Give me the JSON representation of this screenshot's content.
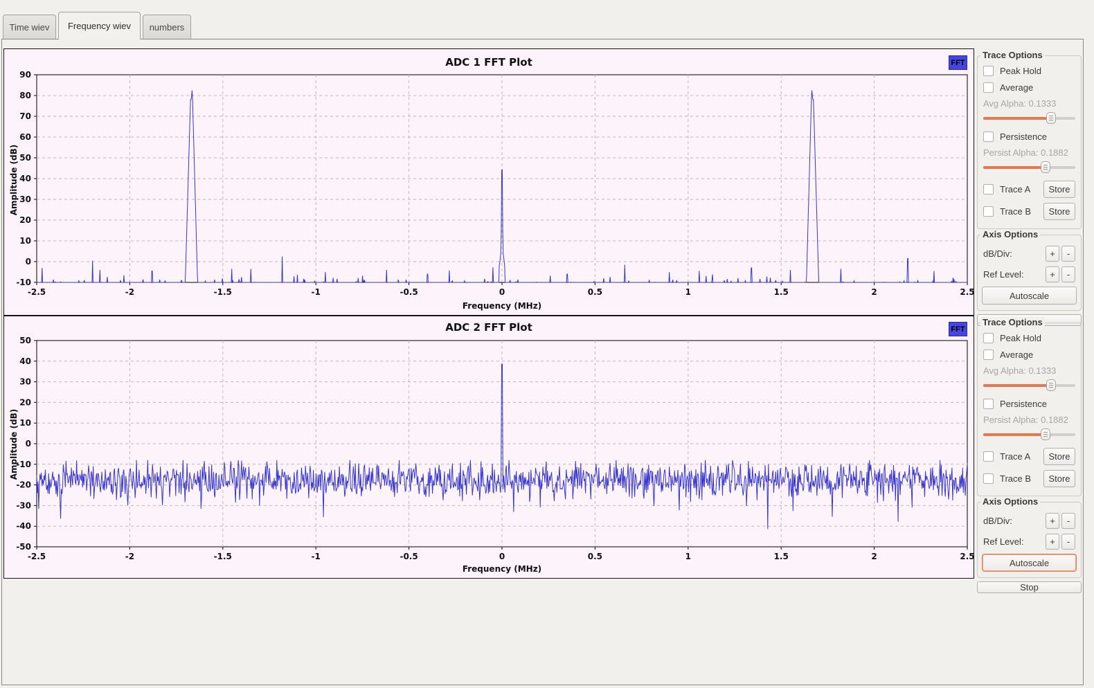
{
  "tabs": [
    {
      "label": "Time wiev",
      "active": false
    },
    {
      "label": "Frequency wiev",
      "active": true
    },
    {
      "label": "numbers",
      "active": false
    }
  ],
  "controls": {
    "trace_options_title": "Trace Options",
    "peak_hold": "Peak Hold",
    "average": "Average",
    "avg_alpha_label": "Avg Alpha: 0.1333",
    "persistence": "Persistence",
    "persist_alpha_label": "Persist Alpha: 0.1882",
    "trace_a": "Trace A",
    "trace_b": "Trace B",
    "store": "Store",
    "axis_options_title": "Axis Options",
    "db_div_label": "dB/Div:",
    "ref_level_label": "Ref Level:",
    "plus": "+",
    "minus": "-",
    "autoscale": "Autoscale",
    "stop": "Stop",
    "avg_alpha_fraction": 0.74,
    "persist_alpha_fraction": 0.68
  },
  "chart_data": [
    {
      "type": "line",
      "title": "ADC 1 FFT Plot",
      "badge": "FFT",
      "xlabel": "Frequency (MHz)",
      "ylabel": "Amplitude (dB)",
      "xlim": [
        -2.5,
        2.5
      ],
      "ylim": [
        -10,
        90
      ],
      "xticks": [
        -2.5,
        -2,
        -1.5,
        -1,
        -0.5,
        0,
        0.5,
        1,
        1.5,
        2,
        2.5
      ],
      "xtick_labels": [
        "-2.5",
        "-2",
        "-1.5",
        "-1",
        "-0.5",
        "0",
        "0.5",
        "1",
        "1.5",
        "2",
        "2.5"
      ],
      "yticks": [
        90,
        80,
        70,
        60,
        50,
        40,
        30,
        20,
        10,
        0,
        -10
      ],
      "grid": true,
      "bg": "#fdf4fb",
      "grid_color": "#b9b9b9",
      "trace_color": "#3636d2",
      "noise": {
        "type": "sparse",
        "seed": 1337,
        "samples": 1900,
        "baseline": -10,
        "spur_probability": 0.05,
        "spur_scale": 1.6,
        "spur_max": -2.5
      },
      "peaks": [
        {
          "f": -1.672,
          "a": 78.0,
          "wt": 0.0015,
          "wb": 0.03
        },
        {
          "f": -1.6655,
          "a": 82.5,
          "wt": 0.0015,
          "wb": 0.03
        },
        {
          "f": 0.0,
          "a": 45.5,
          "wt": 0.0012,
          "wb": 0.006
        },
        {
          "f": 1.6655,
          "a": 82.5,
          "wt": 0.0015,
          "wb": 0.03
        },
        {
          "f": 1.672,
          "a": 78.0,
          "wt": 0.0015,
          "wb": 0.03
        }
      ],
      "pedestals": [
        {
          "f": 0.0,
          "a": 9.0,
          "halfwidth": 0.016
        }
      ],
      "spurs": [
        [
          -2.47,
          -3
        ],
        [
          -2.2,
          0.5
        ],
        [
          -2.16,
          -4
        ],
        [
          -1.88,
          -4.5
        ],
        [
          -1.35,
          -3.5
        ],
        [
          -1.18,
          2.5
        ],
        [
          -0.95,
          -5
        ],
        [
          -0.62,
          -4
        ],
        [
          -0.4,
          -6
        ],
        [
          0.35,
          -6
        ],
        [
          0.66,
          -1.5
        ],
        [
          0.9,
          -5
        ],
        [
          1.34,
          -3
        ],
        [
          1.55,
          -4
        ],
        [
          1.82,
          -3.5
        ],
        [
          2.18,
          1.5
        ],
        [
          2.32,
          -4.5
        ]
      ]
    },
    {
      "type": "line",
      "title": "ADC 2 FFT Plot",
      "badge": "FFT",
      "xlabel": "Frequency (MHz)",
      "ylabel": "Amplitude (dB)",
      "xlim": [
        -2.5,
        2.5
      ],
      "ylim": [
        -50,
        50
      ],
      "xticks": [
        -2.5,
        -2,
        -1.5,
        -1,
        -0.5,
        0,
        0.5,
        1,
        1.5,
        2,
        2.5
      ],
      "xtick_labels": [
        "-2.5",
        "-2",
        "-1.5",
        "-1",
        "-0.5",
        "0",
        "0.5",
        "1",
        "1.5",
        "2",
        "2.5"
      ],
      "yticks": [
        50,
        40,
        30,
        20,
        10,
        0,
        -10,
        -20,
        -30,
        -40,
        -50
      ],
      "grid": true,
      "bg": "#fdf4fb",
      "grid_color": "#b9b9b9",
      "trace_color": "#3636d2",
      "noise": {
        "type": "dense",
        "seed": 99,
        "samples": 1400,
        "mean": -17.5,
        "sigma": 4.2,
        "min": -46,
        "max": -8,
        "dip_probability": 0.012,
        "dip_depth": 12
      },
      "peaks": [
        {
          "f": 0.0,
          "a": 48.5,
          "wt": 0.0012,
          "wb": 0.007
        }
      ],
      "pedestals": [],
      "spurs": []
    }
  ]
}
